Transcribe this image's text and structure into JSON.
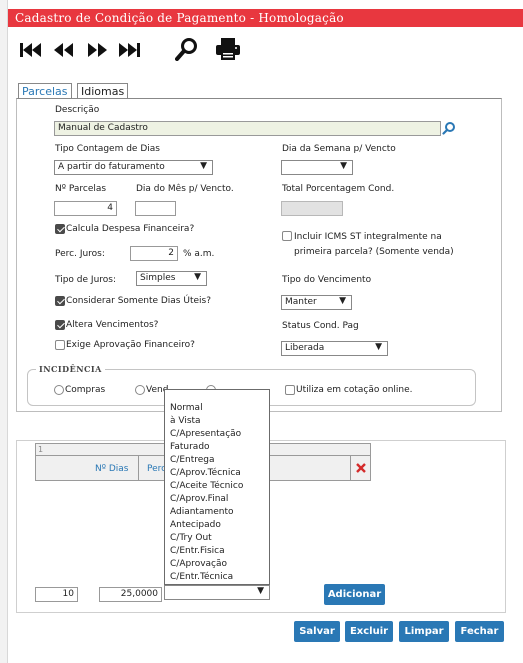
{
  "window": {
    "title": "Cadastro de Condição de Pagamento  - Homologação"
  },
  "toolbar": {
    "first_icon": "first-record-icon",
    "prev_icon": "previous-record-icon",
    "next_icon": "next-record-icon",
    "last_icon": "last-record-icon",
    "search_icon": "search-icon",
    "print_icon": "print-icon"
  },
  "tabs": [
    {
      "label": "Parcelas",
      "active": true
    },
    {
      "label": "Idiomas",
      "active": false
    }
  ],
  "form": {
    "descricao_label": "Descrição",
    "descricao_value": "Manual de Cadastro",
    "tipo_contagem_label": "Tipo Contagem de Dias",
    "tipo_contagem_value": "A partir do faturamento",
    "dia_semana_label": "Dia da Semana p/ Vencto",
    "dia_semana_value": "",
    "n_parcelas_label": "Nº Parcelas",
    "n_parcelas_value": "4",
    "dia_mes_label": "Dia do Mês p/ Vencto.",
    "dia_mes_value": "",
    "total_porcentagem_label": "Total Porcentagem Cond.",
    "total_porcentagem_value": "",
    "calcula_despesa_label": "Calcula Despesa Financeira?",
    "incluir_icms_label": "Incluir ICMS ST integralmente na primeira parcela? (Somente venda)",
    "perc_juros_label": "Perc. Juros:",
    "perc_juros_value": "2",
    "perc_juros_unit": "% a.m.",
    "tipo_juros_label": "Tipo de Juros:",
    "tipo_juros_value": "Simples",
    "tipo_vencimento_label": "Tipo do Vencimento",
    "considerar_dias_uteis_label": "Considerar Somente Dias Úteis?",
    "tipo_vencimento_value": "Manter",
    "altera_vencimentos_label": "Altera Vencimentos?",
    "status_label": "Status Cond. Pag",
    "exige_aprovacao_label": "Exige Aprovação Financeiro?",
    "status_value": "Liberada"
  },
  "incidencia": {
    "legend": "Incidência",
    "compras_label": "Compras",
    "vendas_label": "Vend",
    "ambos_label": "",
    "cotacao_label": "Utiliza em cotação online."
  },
  "grid": {
    "page_number": "1",
    "col_dias": "Nº Dias",
    "col_perc": "Perc",
    "delete_icon": "delete-x-icon",
    "new_dias_value": "10",
    "new_perc_value": "25,0000",
    "add_label": "Adicionar"
  },
  "dropdown": {
    "options": [
      "Normal",
      "à Vista",
      "C/Apresentação",
      "Faturado",
      "C/Entrega",
      "C/Aprov.Técnica",
      "C/Aceite Técnico",
      "C/Aprov.Final",
      "Adiantamento",
      "Antecipado",
      "C/Try Out",
      "C/Entr.Fisica",
      "C/Aprovação",
      "C/Entr.Técnica"
    ]
  },
  "actions": {
    "save": "Salvar",
    "delete": "Excluir",
    "clear": "Limpar",
    "close": "Fechar"
  },
  "colors": {
    "title_bar": "#e8373f",
    "primary_button": "#2a78b5",
    "link_text": "#2a78b5",
    "delete_icon": "#d42b2b"
  }
}
